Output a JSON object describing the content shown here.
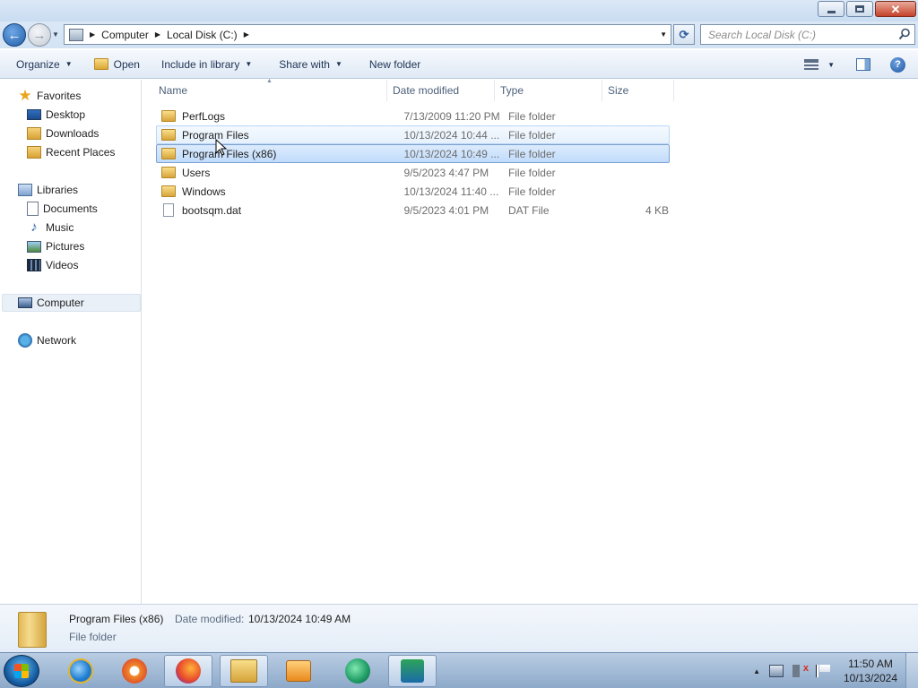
{
  "window": {
    "minimize_icon": "minimize-icon",
    "maximize_icon": "maximize-icon",
    "close_glyph": "✕"
  },
  "address": {
    "crumbs": [
      "Computer",
      "Local Disk (C:)"
    ],
    "search_placeholder": "Search Local Disk (C:)"
  },
  "toolbar": {
    "organize": "Organize",
    "open": "Open",
    "include_in_library": "Include in library",
    "share_with": "Share with",
    "new_folder": "New folder"
  },
  "navpane": {
    "favorites": "Favorites",
    "desktop": "Desktop",
    "downloads": "Downloads",
    "recent_places": "Recent Places",
    "libraries": "Libraries",
    "documents": "Documents",
    "music": "Music",
    "pictures": "Pictures",
    "videos": "Videos",
    "computer": "Computer",
    "network": "Network"
  },
  "columns": {
    "name": "Name",
    "date_modified": "Date modified",
    "type": "Type",
    "size": "Size"
  },
  "files": [
    {
      "name": "PerfLogs",
      "date": "7/13/2009 11:20 PM",
      "type": "File folder",
      "size": "",
      "icon": "folder-icon"
    },
    {
      "name": "Program Files",
      "date": "10/13/2024 10:44 ...",
      "type": "File folder",
      "size": "",
      "icon": "folder-icon"
    },
    {
      "name": "Program Files (x86)",
      "date": "10/13/2024 10:49 ...",
      "type": "File folder",
      "size": "",
      "icon": "folder-icon"
    },
    {
      "name": "Users",
      "date": "9/5/2023 4:47 PM",
      "type": "File folder",
      "size": "",
      "icon": "folder-icon"
    },
    {
      "name": "Windows",
      "date": "10/13/2024 11:40 ...",
      "type": "File folder",
      "size": "",
      "icon": "folder-icon"
    },
    {
      "name": "bootsqm.dat",
      "date": "9/5/2023 4:01 PM",
      "type": "DAT File",
      "size": "4 KB",
      "icon": "file-icon"
    }
  ],
  "details": {
    "name": "Program Files (x86)",
    "date_label": "Date modified:",
    "date": "10/13/2024 10:49 AM",
    "type": "File folder"
  },
  "taskbar": {
    "time": "11:50 AM",
    "date": "10/13/2024"
  }
}
